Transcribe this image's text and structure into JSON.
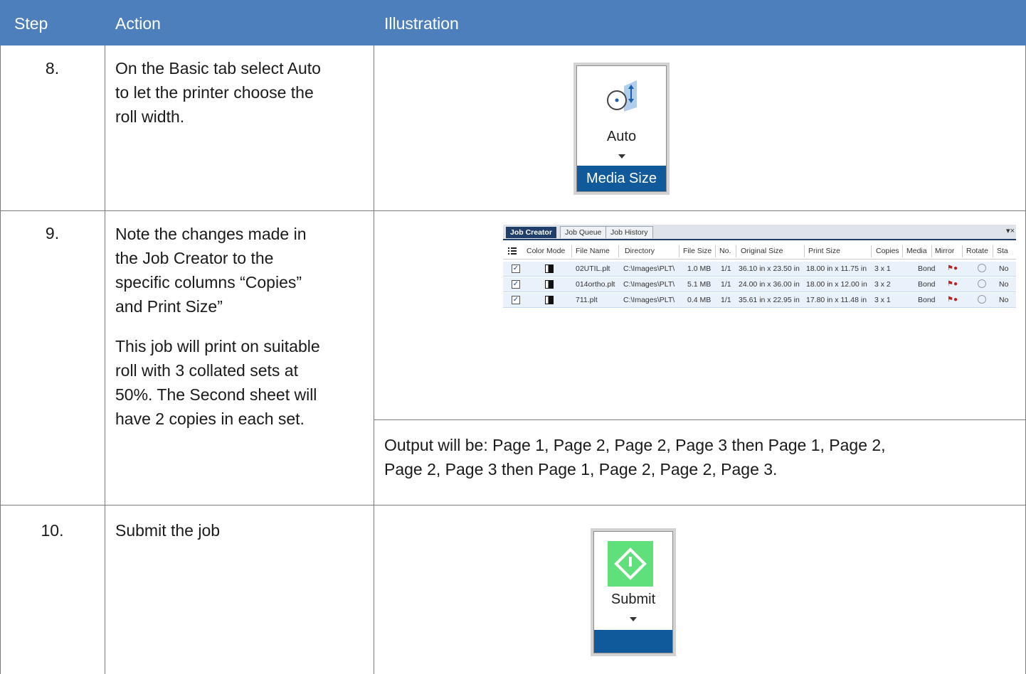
{
  "header": {
    "step": "Step",
    "action": "Action",
    "illustration": "Illustration"
  },
  "colors": {
    "header_bg": "#4e7fbd",
    "widget_bar": "#105a9c",
    "submit_green": "#5fe07a",
    "job_tab_active": "#1f3f6a"
  },
  "rows": [
    {
      "step": "8.",
      "action_lines": [
        "On the Basic tab select Auto",
        "to let the printer choose the",
        "roll width."
      ],
      "widget": {
        "label": "Auto",
        "bar": "Media Size",
        "icon": "media-size-icon"
      }
    },
    {
      "step": "9.",
      "action_lines": [
        "Note the changes made in",
        "the Job Creator to the",
        "specific columns “Copies”",
        "and Print Size”"
      ],
      "note_lines": [
        "This job will print on suitable",
        "roll with 3 collated sets at",
        "50%. The Second sheet will",
        "have 2 copies in each set."
      ],
      "output_lines": [
        "Output will be: Page 1, Page 2, Page 2, Page 3 then Page 1, Page 2,",
        "Page 2, Page 3 then Page 1, Page 2, Page 2, Page 3."
      ]
    },
    {
      "step": "10.",
      "action_lines": [
        "Submit the job"
      ],
      "widget": {
        "label": "Submit",
        "icon": "submit-icon"
      }
    }
  ],
  "job_creator": {
    "tabs": [
      "Job Creator",
      "Job Queue",
      "Job History"
    ],
    "menu": "▾×",
    "columns": [
      "Color Mode",
      "File Name",
      "Directory",
      "File Size",
      "No.",
      "Original Size",
      "Print Size",
      "Copies",
      "Media",
      "Mirror",
      "Rotate",
      "Sta"
    ],
    "rows": [
      {
        "file": "02UTIL.plt",
        "dir": "C:\\Images\\PLT\\",
        "size": "1.0 MB",
        "no": "1/1",
        "orig": "36.10 in x 23.50 in",
        "print": "18.00 in x 11.75 in",
        "copies": "3 x 1",
        "media": "Bond",
        "status": "No"
      },
      {
        "file": "014ortho.plt",
        "dir": "C:\\Images\\PLT\\",
        "size": "5.1 MB",
        "no": "1/1",
        "orig": "24.00 in x 36.00 in",
        "print": "18.00 in x 12.00 in",
        "copies": "3 x 2",
        "media": "Bond",
        "status": "No"
      },
      {
        "file": "711.plt",
        "dir": "C:\\Images\\PLT\\",
        "size": "0.4 MB",
        "no": "1/1",
        "orig": "35.61 in x 22.95 in",
        "print": "17.80 in x 11.48 in",
        "copies": "3 x 1",
        "media": "Bond",
        "status": "No"
      }
    ]
  }
}
